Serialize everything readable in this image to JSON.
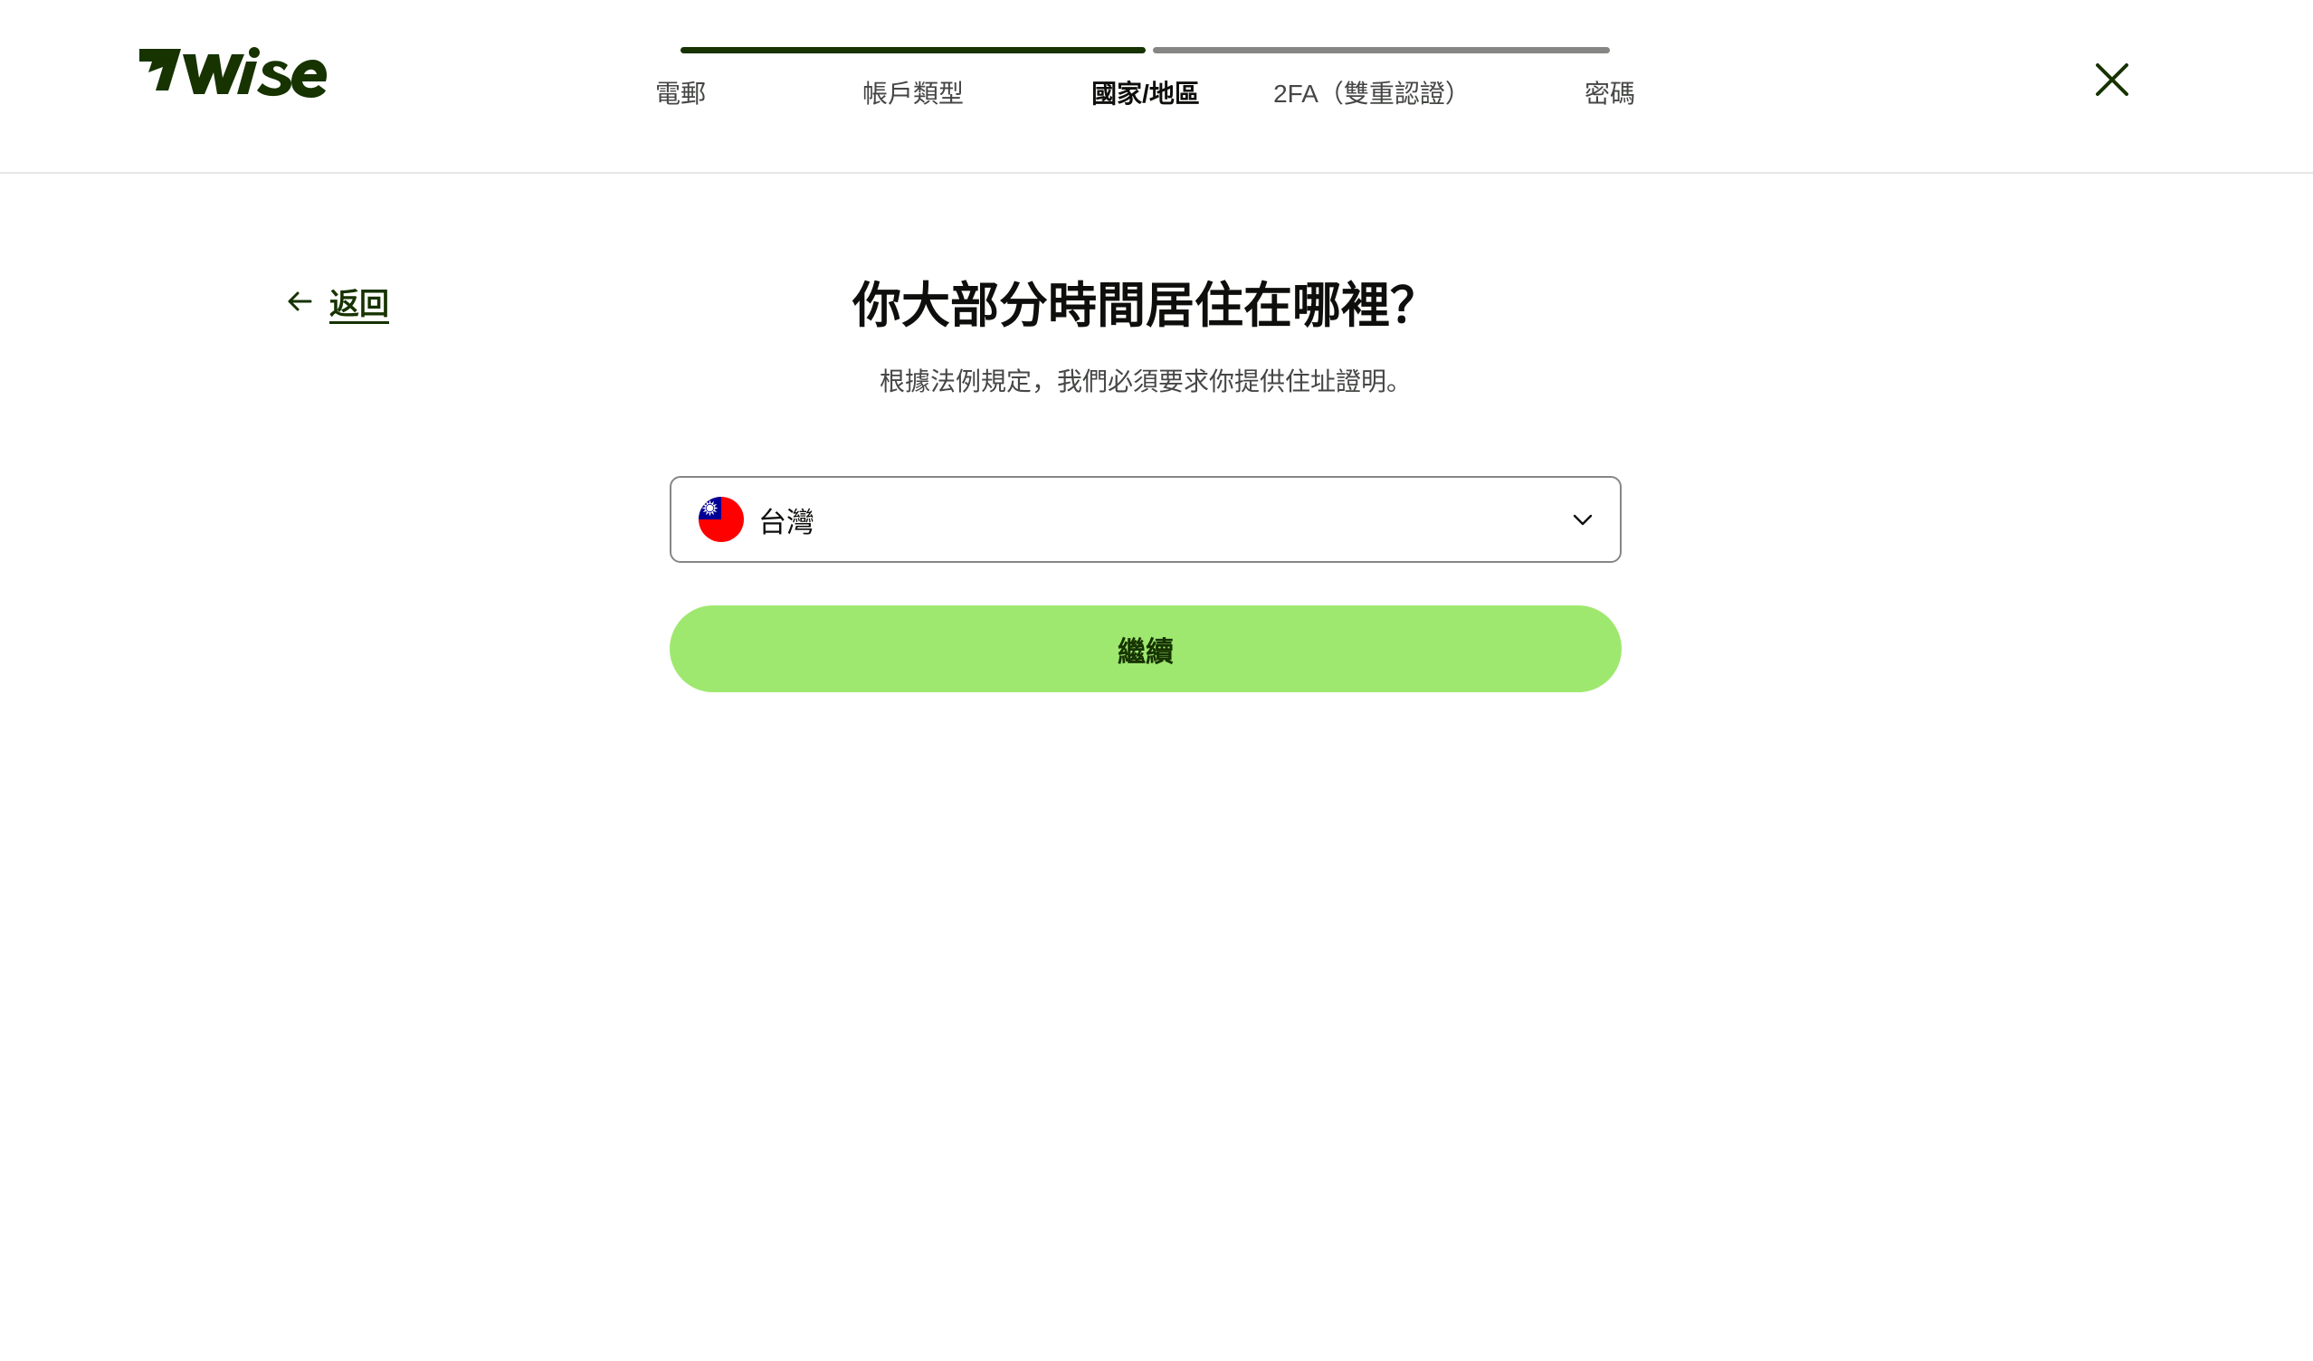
{
  "brand": {
    "logo_text": "7WISE",
    "color_primary": "#163300",
    "color_accent": "#9fe870"
  },
  "progress": {
    "done_color": "#163300",
    "todo_color": "#868685",
    "completed_fraction": 0.5,
    "steps": [
      {
        "label": "電郵",
        "state": "done"
      },
      {
        "label": "帳戶類型",
        "state": "done"
      },
      {
        "label": "國家/地區",
        "state": "current"
      },
      {
        "label": "2FA（雙重認證）",
        "state": "upcoming"
      },
      {
        "label": "密碼",
        "state": "upcoming"
      }
    ]
  },
  "header": {
    "close_icon": "close-icon"
  },
  "back": {
    "label": "返回",
    "icon": "arrow-left-icon"
  },
  "main": {
    "title": "你大部分時間居住在哪裡？",
    "subtitle": "根據法例規定，我們必須要求你提供住址證明。",
    "country_select": {
      "selected_value": "台灣",
      "flag_icon": "taiwan-flag-icon",
      "chevron_icon": "chevron-down-icon"
    },
    "continue_button": {
      "label": "繼續"
    }
  }
}
